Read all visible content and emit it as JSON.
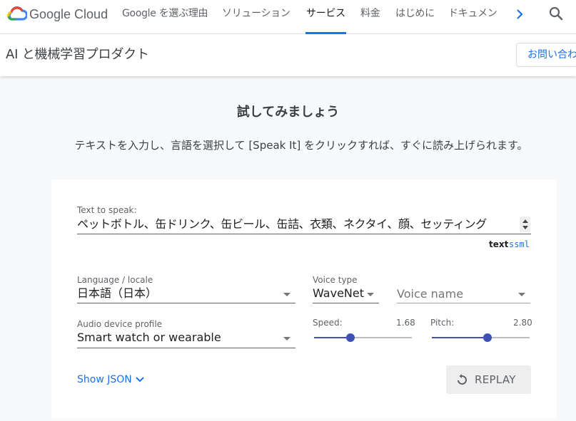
{
  "header": {
    "brand": "Google Cloud",
    "nav": [
      {
        "label": "Google を選ぶ理由",
        "active": false
      },
      {
        "label": "ソリューション",
        "active": false
      },
      {
        "label": "サービス",
        "active": true
      },
      {
        "label": "料金",
        "active": false
      },
      {
        "label": "はじめに",
        "active": false
      },
      {
        "label": "ドキュメン",
        "active": false
      }
    ],
    "more_icon": "chevron-right-icon",
    "search_icon": "search-icon"
  },
  "subheader": {
    "title": "AI と機械学習プロダクト",
    "contact_label": "お問い合わ"
  },
  "hero": {
    "title": "試してみましょう",
    "subtitle": "テキストを入力し、言語を選択して [Speak It] をクリックすれば、すぐに読み上げられます。"
  },
  "demo": {
    "text_label": "Text to speak:",
    "text_value": "ペットボトル、缶ドリンク、缶ビール、缶詰、衣類、ネクタイ、顔、セッティング",
    "mode_text": "text",
    "mode_ssml": "ssml",
    "language_label": "Language / locale",
    "language_value": "日本語（日本）",
    "voice_type_label": "Voice type",
    "voice_type_value": "WaveNet",
    "voice_name_placeholder": "Voice name",
    "audio_label": "Audio device profile",
    "audio_value": "Smart watch or wearable",
    "speed_label": "Speed:",
    "speed_value": "1.68",
    "speed_fraction": 0.37,
    "pitch_label": "Pitch:",
    "pitch_value": "2.80",
    "pitch_fraction": 0.57,
    "show_json_label": "Show JSON",
    "replay_label": "REPLAY"
  },
  "colors": {
    "accent": "#1a73e8",
    "slider": "#3f51b5",
    "background": "#f8f9fa"
  }
}
